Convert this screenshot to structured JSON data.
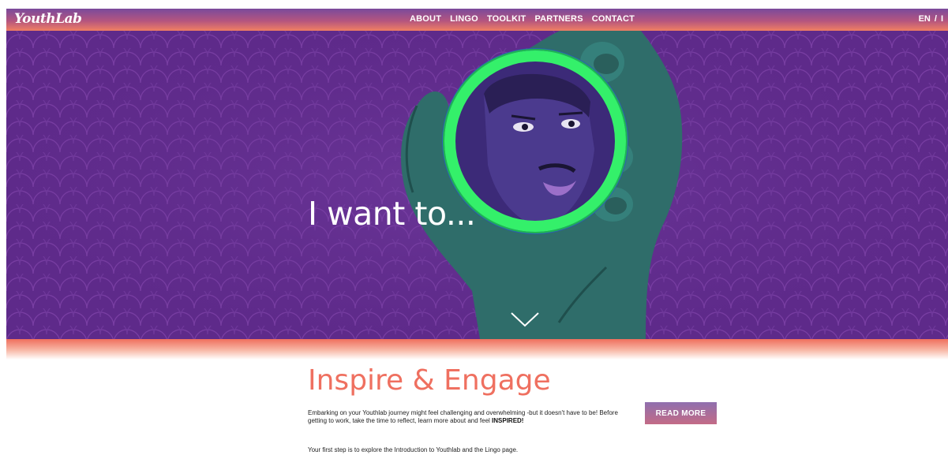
{
  "header": {
    "logo": "YouthLab",
    "nav": [
      "ABOUT",
      "LINGO",
      "TOOLKIT",
      "PARTNERS",
      "CONTACT"
    ],
    "lang": {
      "current": "EN",
      "sep": "/",
      "other": "I"
    }
  },
  "hero": {
    "headline": "I want to...",
    "icon": "chevron-down-icon"
  },
  "section": {
    "title": "Inspire & Engage",
    "intro_text": "Embarking on your Youthlab journey might feel challenging and overwhelming -but it doesn't have to be! Before getting to work, take the time to reflect, learn more about and feel ",
    "intro_bold": "INSPIRED!",
    "first_step": "Your first step is to explore the Introduction to Youthlab and the Lingo page.",
    "read_more": "READ MORE"
  },
  "colors": {
    "accent": "#ef7060",
    "hero_bg": "#5e2a8a",
    "ring": "#34f06a",
    "skin": "#2f6d6a"
  }
}
